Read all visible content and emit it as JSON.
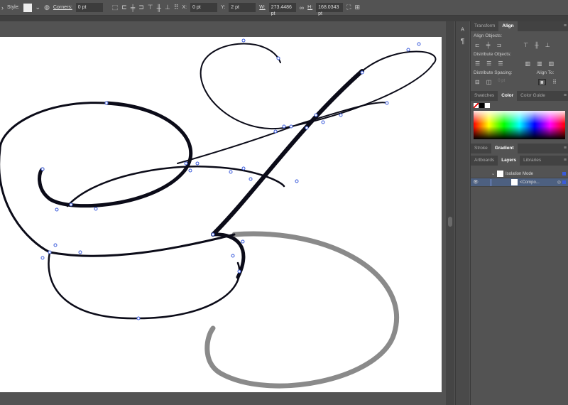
{
  "control_bar": {
    "style_label": "Style:",
    "corners_label": "Corners:",
    "corners_value": "0 pt",
    "x_label": "X:",
    "x_value": "0 pt",
    "y_label": "Y:",
    "y_value": "2 pt",
    "w_label": "W:",
    "w_value": "273.4486 pt",
    "h_label": "H:",
    "h_value": "168.0343 pt"
  },
  "align_panel": {
    "tabs": [
      "Transform",
      "Align"
    ],
    "align_objects": "Align Objects:",
    "distribute_objects": "Distribute Objects:",
    "distribute_spacing": "Distribute Spacing:",
    "spacing_value": "0 pt",
    "align_to": "Align To:"
  },
  "color_panel": {
    "tabs": [
      "Swatches",
      "Color",
      "Color Guide"
    ]
  },
  "gradient_panel": {
    "tabs": [
      "Stroke",
      "Gradient"
    ]
  },
  "layers_panel": {
    "tabs": [
      "Artboards",
      "Layers",
      "Libraries"
    ],
    "rows": [
      {
        "name": "Isolation Mode"
      },
      {
        "name": "<Compo..."
      }
    ]
  },
  "colors": {
    "selection": "#3b5bdb",
    "shadow": "#8a8a8a"
  }
}
